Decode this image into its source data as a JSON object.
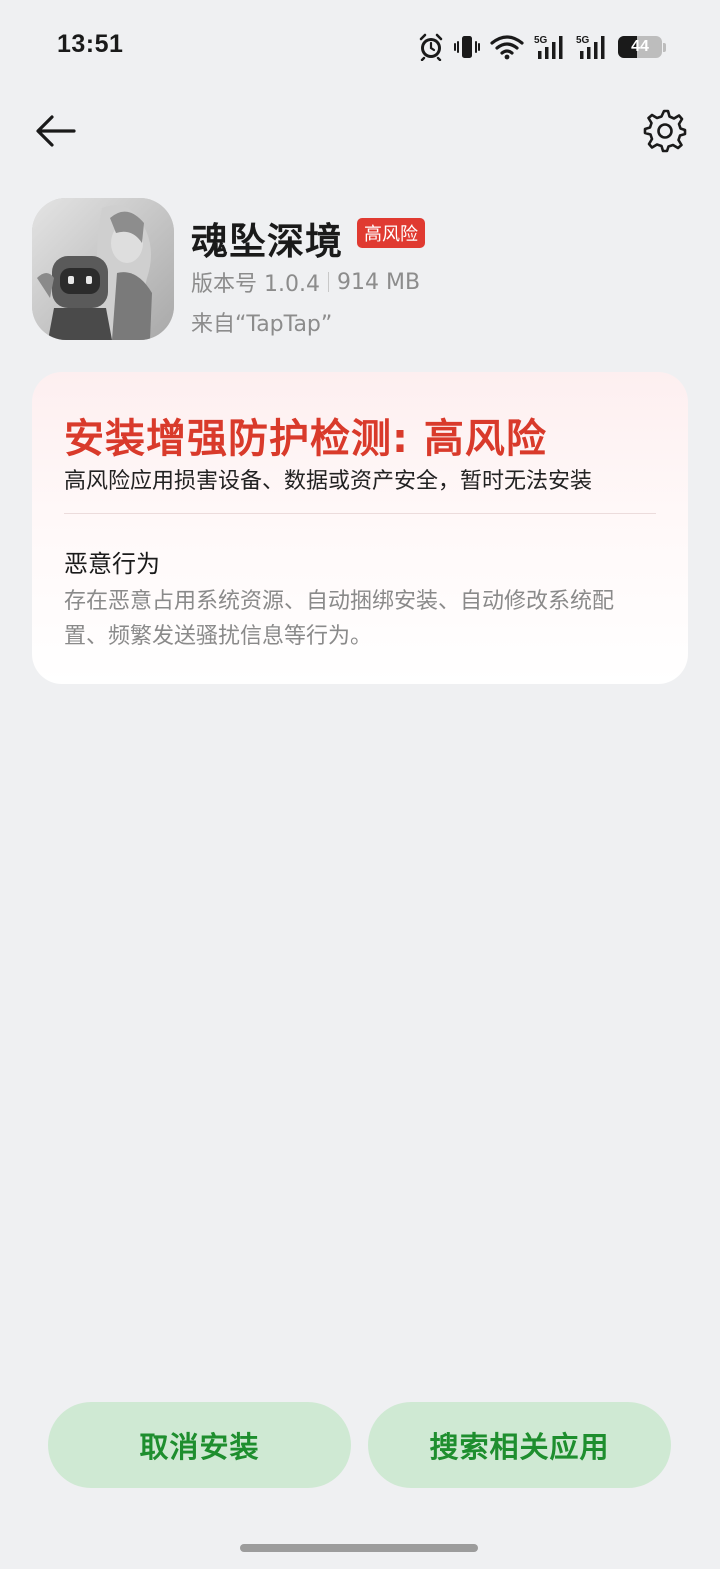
{
  "status_bar": {
    "time": "13:51",
    "icons": [
      "alarm-icon",
      "vibrate-icon",
      "wifi-icon",
      "signal-5g-icon",
      "signal-5g-icon",
      "battery-icon"
    ],
    "network_label": "5G",
    "battery_level": "44",
    "battery_fraction": 0.44
  },
  "nav": {
    "back_icon": "arrow-left-icon",
    "settings_icon": "gear-icon"
  },
  "app": {
    "name": "魂坠深境",
    "risk_badge": "高风险",
    "version": "版本号 1.0.4",
    "size": "914 MB",
    "source": "来自“TapTap”"
  },
  "card": {
    "title": "安装增强防护检测: 高风险",
    "subtitle": "高风险应用损害设备、数据或资产安全，暂时无法安装",
    "section_title": "恶意行为",
    "section_desc": "存在恶意占用系统资源、自动捆绑安装、自动修改系统配置、频繁发送骚扰信息等行为。"
  },
  "buttons": {
    "cancel": "取消安装",
    "search": "搜索相关应用"
  },
  "colors": {
    "accent_red": "#d93a2b",
    "badge_red": "#e03a31",
    "button_bg": "#cfe9d3",
    "button_text": "#1e8e2e"
  }
}
